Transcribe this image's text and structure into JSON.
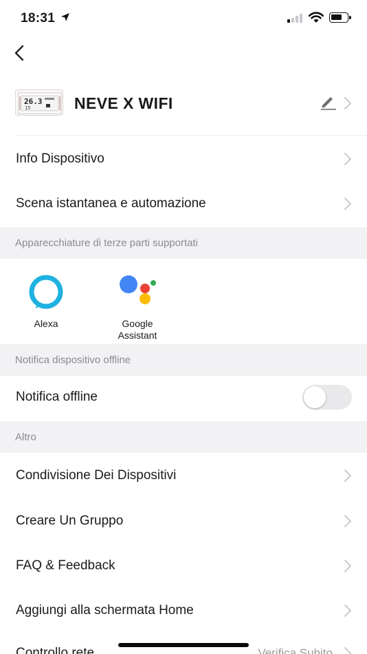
{
  "status_bar": {
    "time": "18:31"
  },
  "device": {
    "name": "NEVE X WIFI",
    "thumb_main": "26.3",
    "thumb_sub": "15"
  },
  "menu_top": [
    {
      "label": "Info Dispositivo"
    },
    {
      "label": "Scena istantanea e automazione"
    }
  ],
  "sections": {
    "third_party": "Apparecchiature di terze parti supportati",
    "offline": "Notifica dispositivo offline",
    "other": "Altro"
  },
  "assistants": [
    {
      "line1": "Alexa",
      "line2": ""
    },
    {
      "line1": "Google",
      "line2": "Assistant"
    }
  ],
  "offline_row": {
    "label": "Notifica offline",
    "enabled": false
  },
  "menu_other": [
    {
      "label": "Condivisione Dei Dispositivi"
    },
    {
      "label": "Creare Un Gruppo"
    },
    {
      "label": "FAQ & Feedback"
    },
    {
      "label": "Aggiungi alla schermata Home"
    },
    {
      "label": "Controllo rete",
      "value": "Verifica Subito"
    }
  ],
  "colors": {
    "alexa": "#1fb2e1",
    "google_blue": "#4285f4",
    "google_red": "#ea4335",
    "google_yellow": "#fbbc05",
    "google_green": "#34a853",
    "section_bg": "#f2f2f4",
    "chevron": "#c4c4c7"
  },
  "icons": {
    "back": "back-chevron-icon",
    "edit": "pencil-icon",
    "chevron": "chevron-right-icon"
  }
}
